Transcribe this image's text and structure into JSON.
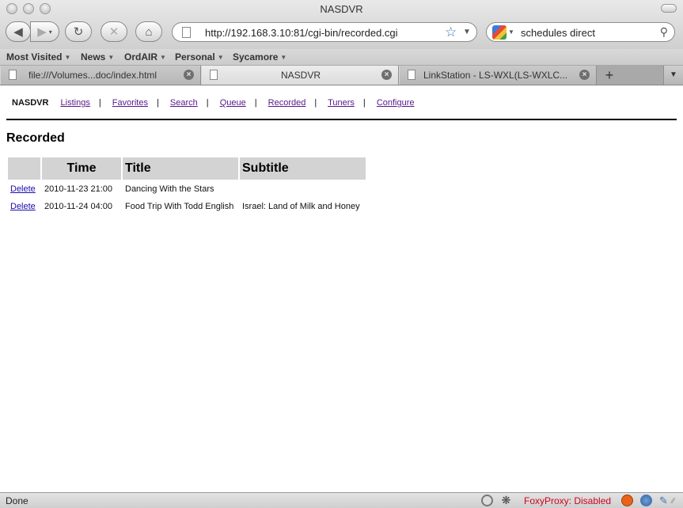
{
  "window": {
    "title": "NASDVR"
  },
  "toolbar": {
    "back_icon": "◀",
    "forward_icon": "▶",
    "reload_icon": "↻",
    "stop_icon": "✕",
    "home_icon": "⌂",
    "url": "http://192.168.3.10:81/cgi-bin/recorded.cgi",
    "search_value": "schedules direct"
  },
  "bookmarks": [
    "Most Visited",
    "News",
    "OrdAIR",
    "Personal",
    "Sycamore"
  ],
  "tabs": [
    {
      "label": "file:///Volumes...doc/index.html",
      "active": false
    },
    {
      "label": "NASDVR",
      "active": true
    },
    {
      "label": "LinkStation - LS-WXL(LS-WXLC...",
      "active": false
    }
  ],
  "page": {
    "brand": "NASDVR",
    "nav": [
      "Listings",
      "Favorites",
      "Search",
      "Queue",
      "Recorded",
      "Tuners",
      "Configure"
    ],
    "heading": "Recorded",
    "table": {
      "headers": [
        "",
        "Time",
        "Title",
        "Subtitle"
      ],
      "rows": [
        {
          "action": "Delete",
          "time": "2010-11-23 21:00",
          "title": "Dancing With the Stars",
          "subtitle": ""
        },
        {
          "action": "Delete",
          "time": "2010-11-24 04:00",
          "title": "Food Trip With Todd English",
          "subtitle": "Israel: Land of Milk and Honey"
        }
      ]
    }
  },
  "status": {
    "text": "Done",
    "foxyproxy": "FoxyProxy: Disabled"
  },
  "colors": {
    "visited_link": "#551a8b",
    "link": "#1a0dab",
    "table_header_bg": "#d3d3d3",
    "foxyproxy_red": "#d0021b"
  }
}
